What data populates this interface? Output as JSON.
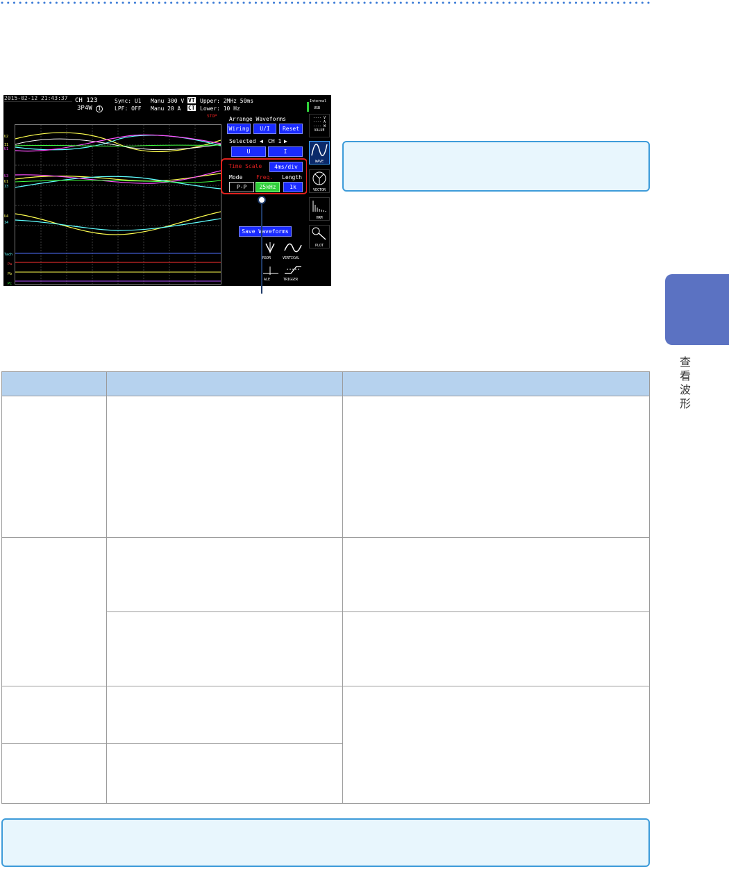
{
  "screen": {
    "datetime": "2015-02-12 21:43:37",
    "channel": "CH 123",
    "wiring_mode": "3P4W",
    "wiring_num": "1",
    "sync": "Sync: U1",
    "lpf": "LPF: OFF",
    "manu_v": "Manu 300 V",
    "manu_a": "Manu  20 A",
    "vt": "VT",
    "ct": "CT",
    "upper": "Upper:  2MHz  50ms",
    "lower": "Lower:  10 Hz",
    "stop": "STOP",
    "arrange_title": "Arrange Waveforms",
    "wiring_btn": "Wiring",
    "ui_btn": "U/I",
    "reset_btn": "Reset",
    "selected_label": "Selected",
    "selected_value": "CH 1",
    "u_btn": "U",
    "i_btn": "I",
    "time_scale_label": "Time Scale",
    "time_scale_value": "4ms/div",
    "mode_label": "Mode",
    "freq_label": "Freq.",
    "length_label": "Length",
    "mode_value": "P-P",
    "freq_value": "25kHz",
    "length_value": "1k",
    "save_waveforms": "Save Waveforms",
    "cursor_label": "RSOR",
    "vertical_label": "VERTICAL",
    "scale_label": "ALE",
    "trigger_label": "TRIGGER",
    "rail_internal": "Internal",
    "rail_usb": "USB",
    "rail_value": "VALUE",
    "rail_wave": "WAVE",
    "rail_vector": "VECTOR",
    "rail_hrm": "HRM",
    "rail_plot": "PLOT",
    "legend_v": "---- V",
    "legend_a": "---- A",
    "legend_w": "---- W",
    "ch_labels": [
      "U2",
      "I1",
      "U1",
      "I2",
      "U3",
      "U1",
      "I3",
      "I1",
      "U4",
      "I4",
      "Tach",
      "Pa",
      "Pb",
      "Pc"
    ]
  },
  "side_tab": "查看波形",
  "colors": {
    "accent_blue": "#5b72c2",
    "callout_border": "#3d9bd9",
    "callout_fill": "#e8f6fd",
    "table_header": "#b6d2ee",
    "highlight_red": "#e0201c"
  }
}
